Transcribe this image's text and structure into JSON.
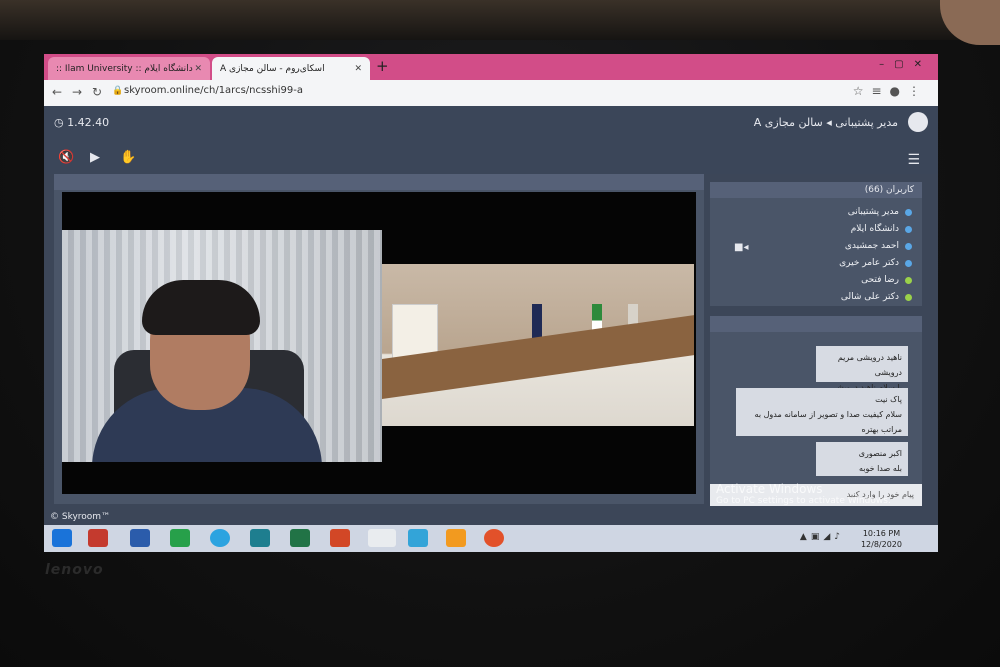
{
  "browser": {
    "tabs": [
      {
        "label": ":: Ilam University :: دانشگاه ایلام"
      },
      {
        "label": "اسکای‌روم - سالن مجازی A"
      }
    ],
    "new_tab": "+",
    "url": "skyroom.online/ch/1arcs/ncsshi99-a"
  },
  "app": {
    "timer": "1.42.40",
    "breadcrumb": "مدیر پشتیبانی ◂ سالن مجازی A",
    "users_header": "کاربران (66)",
    "users": [
      {
        "name": "مدیر پشتیبانی"
      },
      {
        "name": "دانشگاه ایلام"
      },
      {
        "name": "احمد جمشیدی"
      },
      {
        "name": "دکتر عامر خیری"
      },
      {
        "name": "رضا فتحی"
      },
      {
        "name": "دکتر علی شالی"
      }
    ],
    "chat": [
      {
        "sender": "ناهید درویشی مریم درویشی",
        "text": "با سلام ناهید درویشی"
      },
      {
        "sender": "پاک نیت",
        "text": "سلام کیفیت صدا و تصویر از سامانه مدول به مراتب بهتره"
      },
      {
        "sender": "اکبر منصوری",
        "text": "بله صدا خوبه"
      }
    ],
    "chat_placeholder": "پیام خود را وارد کنید",
    "footer": "© Skyroom™"
  },
  "watermark": {
    "title": "Activate Windows",
    "subtitle": "Go to PC settings to activate Windows."
  },
  "taskbar": {
    "time": "10:16 PM",
    "date": "12/8/2020"
  },
  "laptop_brand": "lenovo"
}
